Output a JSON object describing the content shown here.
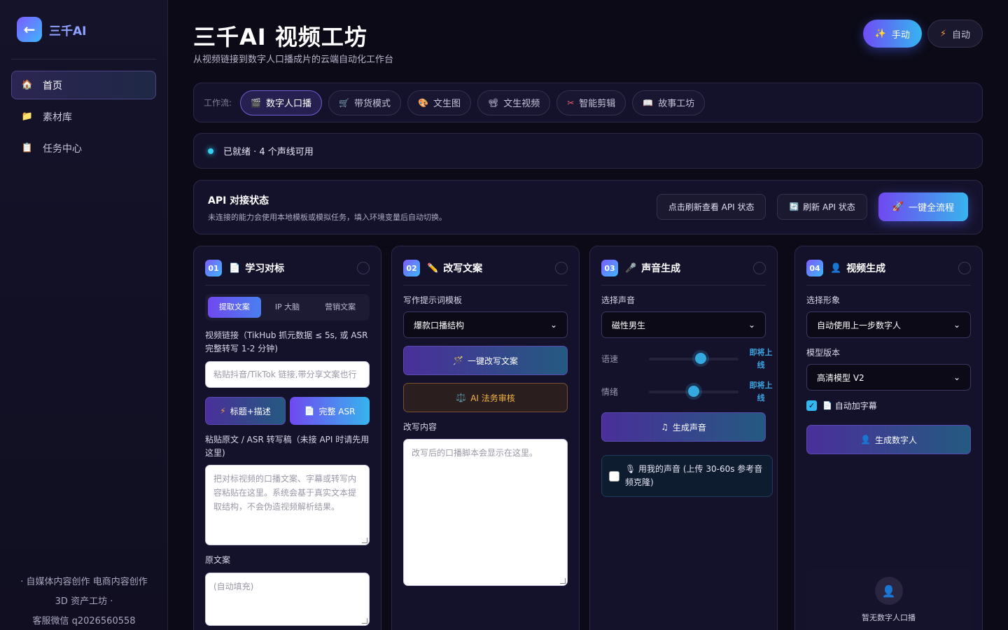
{
  "sidebar": {
    "logo_icon": "←",
    "logo_text": "三千AI",
    "items": [
      {
        "label": "首页",
        "icon": "home-icon",
        "glyph": "🏠"
      },
      {
        "label": "素材库",
        "icon": "folder-icon",
        "glyph": "📁"
      },
      {
        "label": "任务中心",
        "icon": "task-icon",
        "glyph": "📋"
      }
    ],
    "footer": [
      "· 自媒体内容创作  电商内容创作",
      "3D 资产工坊 ·",
      "客服微信 q2026560558"
    ]
  },
  "header": {
    "title": "三千AI 视频工坊",
    "subtitle": "从视频链接到数字人口播成片的云端自动化工作台",
    "mode_manual": "手动",
    "mode_auto": "自动"
  },
  "workflow": {
    "label": "工作流:",
    "chips": [
      {
        "label": "数字人口播",
        "glyph": "🎬"
      },
      {
        "label": "带货模式",
        "glyph": "🛒"
      },
      {
        "label": "文生图",
        "glyph": "🎨"
      },
      {
        "label": "文生视频",
        "glyph": "📽"
      },
      {
        "label": "智能剪辑",
        "glyph": "✂"
      },
      {
        "label": "故事工坊",
        "glyph": "📖"
      }
    ]
  },
  "status": {
    "text": "已就绪 · 4 个声线可用"
  },
  "api": {
    "title": "API 对接状态",
    "desc": "未连接的能力会使用本地模板或模拟任务，填入环境变量后自动切换。",
    "btn_check": "点击刷新查看 API 状态",
    "btn_refresh": "刷新 API 状态",
    "btn_full": "一键全流程"
  },
  "card1": {
    "num": "01",
    "title": "学习对标",
    "tabs": [
      "提取文案",
      "IP 大脑",
      "营销文案"
    ],
    "link_label": "视频链接（TikHub 抓元数据 ≤ 5s, 或 ASR 完整转写 1-2 分钟)",
    "link_placeholder": "粘贴抖音/TikTok 链接,带分享文案也行",
    "btn_title": "标题+描述",
    "btn_asr": "完整 ASR",
    "paste_label": "粘贴原文 / ASR 转写稿（未接 API 时请先用这里)",
    "paste_placeholder": "把对标视频的口播文案、字幕或转写内容粘贴在这里。系统会基于真实文本提取结构，不会伪造视频解析结果。",
    "orig_label": "原文案",
    "orig_placeholder": "(自动填充)"
  },
  "card2": {
    "num": "02",
    "title": "改写文案",
    "tpl_label": "写作提示词模板",
    "tpl_value": "爆款口播结构",
    "btn_rewrite": "一键改写文案",
    "btn_review": "AI 法务审核",
    "content_label": "改写内容",
    "content_placeholder": "改写后的口播脚本会显示在这里。"
  },
  "card3": {
    "num": "03",
    "title": "声音生成",
    "voice_label": "选择声音",
    "voice_value": "磁性男生",
    "speed_label": "语速",
    "speed_value": "即将上线",
    "speed_level": 0.58,
    "emotion_label": "情绪",
    "emotion_value": "即将上线",
    "emotion_level": 0.5,
    "btn_gen": "生成声音",
    "clone_text": "🎙 用我的声音 (上传 30-60s 参考音频克隆)"
  },
  "card4": {
    "num": "04",
    "title": "视频生成",
    "avatar_label": "选择形象",
    "avatar_value": "自动使用上一步数字人",
    "model_label": "模型版本",
    "model_value": "高清模型 V2",
    "subtitle_label": "自动加字幕",
    "btn_gen": "生成数字人",
    "empty_text": "暂无数字人口播"
  },
  "colors": {
    "accent": "#7048f0",
    "accent2": "#38b4ee",
    "bg": "#0b0a16"
  }
}
